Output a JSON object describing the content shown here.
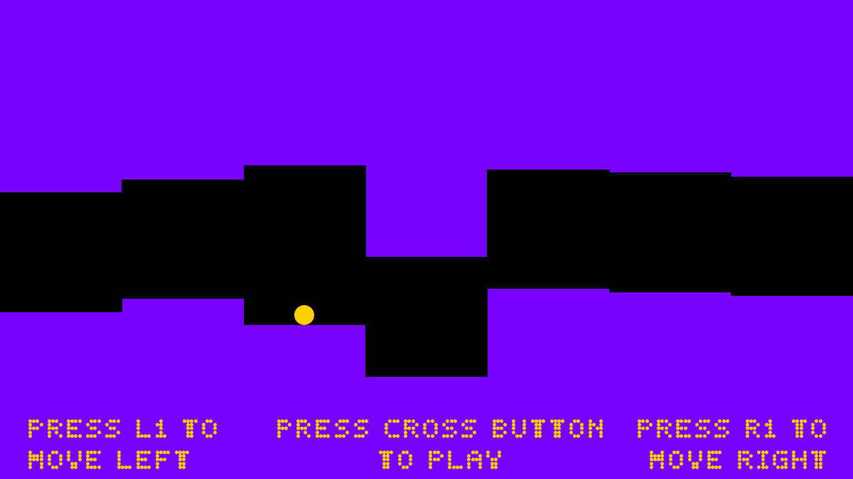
{
  "game": {
    "background_color": "#7700FF",
    "tunnel_color": "#000000",
    "ball_color": "#FFD000",
    "text_color": "#FFD000",
    "tunnel_segments_count": 7
  },
  "instructions": {
    "left": {
      "line1": "PRESS L1 TO",
      "line2": "MOVE LEFT"
    },
    "center": {
      "line1": "PRESS CROSS BUTTON",
      "line2": "TO PLAY"
    },
    "right": {
      "line1": "PRESS R1 TO",
      "line2": "MOVE RIGHT"
    }
  }
}
